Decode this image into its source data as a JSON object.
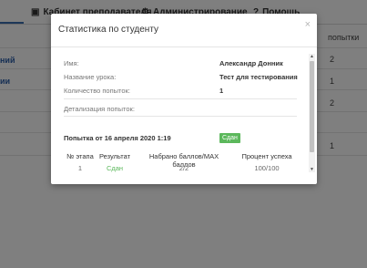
{
  "background": {
    "nav": {
      "cabinet_label": "Кабинет преподавателя",
      "admin_label": "Администрирование",
      "help_label": "Помощь"
    },
    "column_header": "попытки",
    "links": [
      "ний",
      "ии"
    ],
    "values": [
      "2",
      "1",
      "2",
      "1"
    ]
  },
  "modal": {
    "title": "Статистика по студенту",
    "close_symbol": "×",
    "fields": {
      "name_label": "Имя:",
      "name_value": "Александр Донник",
      "lesson_label": "Название урока:",
      "lesson_value": "Тест для тестирования",
      "attempts_label": "Количество попыток:",
      "attempts_value": "1"
    },
    "detail_label": "Детализация попыток:",
    "attempt": {
      "header": "Попытка от 16 апреля 2020 1:19",
      "status": "Сдан"
    },
    "table": {
      "headers": [
        "№ этапа",
        "Результат",
        "Набрано баллов/MAX баллов",
        "Процент успеха"
      ],
      "rows": [
        [
          "1",
          "Сдан",
          "2/2",
          "100/100"
        ]
      ]
    }
  },
  "colors": {
    "success": "#5cb85c",
    "link": "#2a5da8",
    "backdrop": "rgba(0,0,0,0.5)"
  },
  "icons": [
    "briefcase-icon",
    "gear-icon",
    "question-icon",
    "close-icon",
    "scroll-up-icon",
    "scroll-down-icon"
  ]
}
